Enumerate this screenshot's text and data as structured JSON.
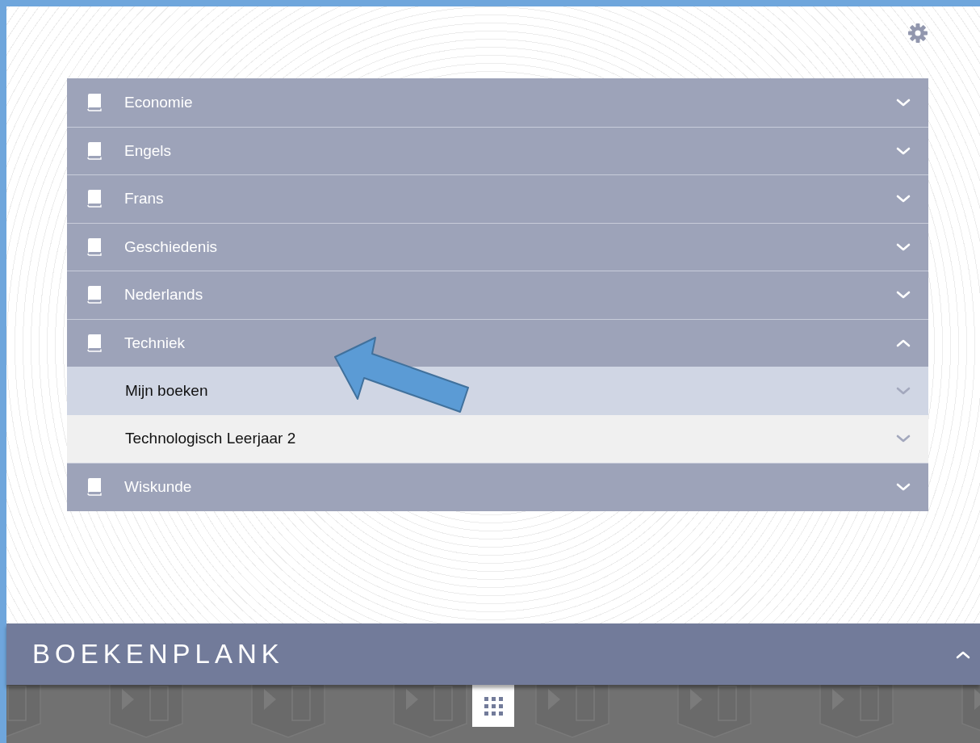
{
  "subjects": [
    {
      "label": "Economie",
      "expanded": false
    },
    {
      "label": "Engels",
      "expanded": false
    },
    {
      "label": "Frans",
      "expanded": false
    },
    {
      "label": "Geschiedenis",
      "expanded": false
    },
    {
      "label": "Nederlands",
      "expanded": false
    },
    {
      "label": "Techniek",
      "expanded": true,
      "children": [
        {
          "label": "Mijn boeken",
          "selected": true
        },
        {
          "label": "Technologisch Leerjaar 2",
          "selected": false
        }
      ]
    },
    {
      "label": "Wiskunde",
      "expanded": false
    }
  ],
  "shelf": {
    "title": "BOEKENPLANK",
    "expanded": true
  }
}
